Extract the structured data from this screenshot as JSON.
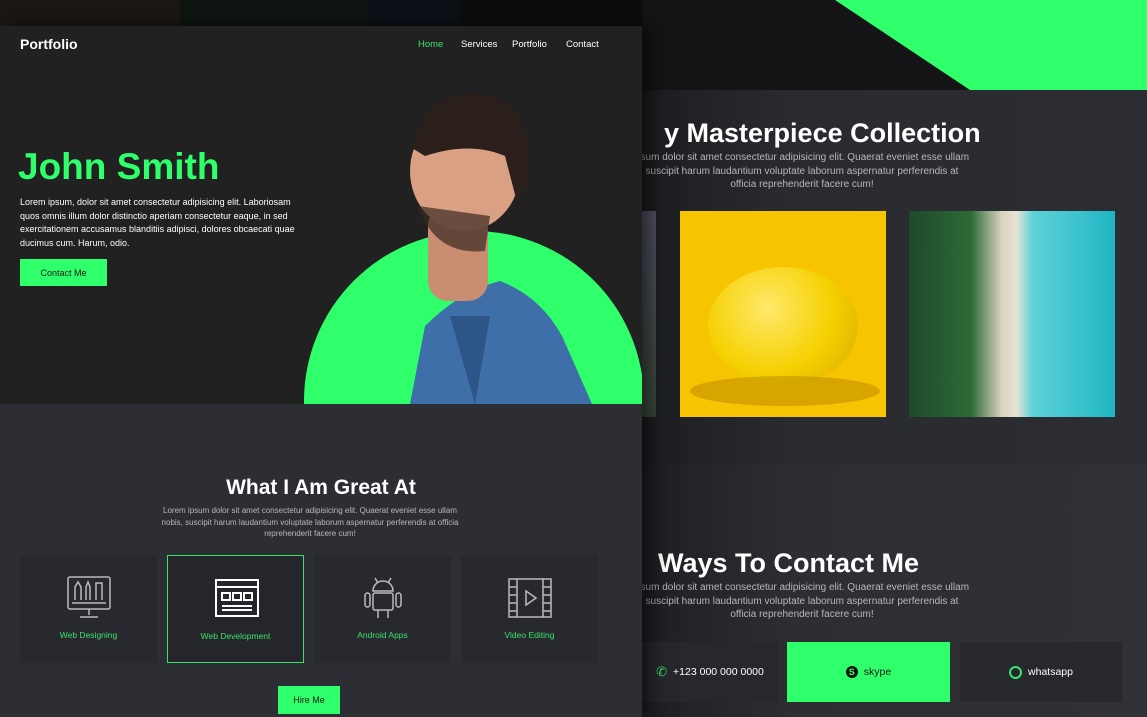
{
  "colors": {
    "accent": "#2fff6a",
    "dark": "#212121",
    "panel": "#2d2e33"
  },
  "header": {
    "brand": "Portfolio",
    "nav": [
      {
        "label": "Home",
        "active": true
      },
      {
        "label": "Services"
      },
      {
        "label": "Portfolio"
      },
      {
        "label": "Contact"
      }
    ]
  },
  "hero": {
    "name": "John Smith",
    "text": "Lorem ipsum, dolor sit amet consectetur adipisicing elit. Laboriosam quos omnis illum dolor distinctio aperiam consectetur eaque, in sed exercitationem accusamus blanditiis adipisci, dolores obcaecati quae ducimus cum. Harum, odio.",
    "cta": "Contact Me"
  },
  "services": {
    "title": "What I Am Great At",
    "text": "Lorem ipsum dolor sit amet consectetur adipisicing elit. Quaerat eveniet esse ullam nobis, suscipit harum laudantium voluptate laborum aspernatur perferendis at officia reprehenderit facere cum!",
    "items": [
      {
        "label": "Web Designing",
        "icon": "monitor-design-icon"
      },
      {
        "label": "Web Development",
        "icon": "browser-window-icon",
        "active": true
      },
      {
        "label": "Android Apps",
        "icon": "android-icon"
      },
      {
        "label": "Video Editing",
        "icon": "film-play-icon"
      }
    ],
    "cta": "Hire Me"
  },
  "portfolio": {
    "title": "y Masterpiece Collection",
    "text": "psum dolor sit amet consectetur adipisicing elit. Quaerat eveniet esse ullam suscipit harum laudantium voluptate laborum aspernatur perferendis at officia reprehenderit facere cum!"
  },
  "contact": {
    "title": "Ways To Contact Me",
    "text": "psum dolor sit amet consectetur adipisicing elit. Quaerat eveniet esse ullam suscipit harum laudantium voluptate laborum aspernatur perferendis at officia reprehenderit facere cum!",
    "items": [
      {
        "label": "+123 000 000 0000",
        "icon": "phone-icon"
      },
      {
        "label": "skype",
        "icon": "skype-icon",
        "active": true
      },
      {
        "label": "whatsapp",
        "icon": "whatsapp-icon"
      }
    ]
  }
}
